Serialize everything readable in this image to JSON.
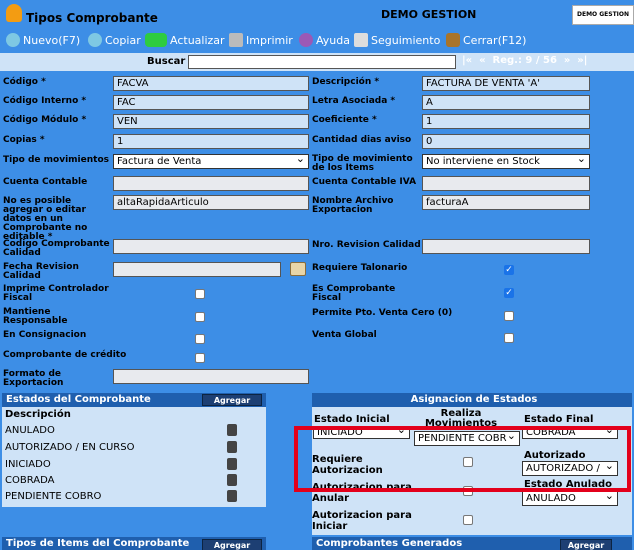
{
  "window": {
    "title": "Tipos Comprobante",
    "app_name": "DEMO GESTION",
    "logo_text": "DEMO GESTION"
  },
  "toolbar": {
    "nuevo": "Nuevo(F7)",
    "copiar": "Copiar",
    "actualizar": "Actualizar",
    "imprimir": "Imprimir",
    "ayuda": "Ayuda",
    "seguimiento": "Seguimiento",
    "cerrar": "Cerrar(F12)"
  },
  "search": {
    "label": "Buscar",
    "value": "",
    "nav": "|«  «  Reg.: 9 / 56  »  »|"
  },
  "form": {
    "codigo": {
      "label": "Código *",
      "value": "FACVA"
    },
    "descripcion": {
      "label": "Descripción *",
      "value": "FACTURA DE VENTA 'A'"
    },
    "codigo_interno": {
      "label": "Código Interno *",
      "value": "FAC"
    },
    "letra_asociada": {
      "label": "Letra Asociada *",
      "value": "A"
    },
    "codigo_modulo": {
      "label": "Código Módulo *",
      "value": "VEN"
    },
    "coeficiente": {
      "label": "Coeficiente *",
      "value": "1"
    },
    "copias": {
      "label": "Copias *",
      "value": "1"
    },
    "cantidad_dias": {
      "label": "Cantidad dias aviso",
      "value": "0"
    },
    "tipo_movimientos": {
      "label": "Tipo de movimientos",
      "value": "Factura de Venta"
    },
    "tipo_mov_items": {
      "label": "Tipo de movimiento de los Items",
      "value": "No interviene en Stock"
    },
    "cuenta_contable": {
      "label": "Cuenta Contable",
      "value": ""
    },
    "cuenta_contable_iva": {
      "label": "Cuenta Contable  IVA",
      "value": ""
    },
    "no_es_posible": {
      "label": "No es posible agregar o editar datos en un Comprobante no editable *",
      "value": "altaRapidaArticulo"
    },
    "nombre_archivo": {
      "label": "Nombre Archivo Exportacion",
      "value": "facturaA"
    },
    "codigo_comp_calidad": {
      "label": "Codigo Comprobante Calidad",
      "value": ""
    },
    "nro_revision": {
      "label": "Nro. Revision Calidad",
      "value": ""
    },
    "fecha_revision": {
      "label": "Fecha Revision Calidad",
      "value": ""
    },
    "requiere_talonario": {
      "label": "Requiere Talonario",
      "checked": true
    },
    "imprime_controlador": {
      "label": "Imprime Controlador Fiscal",
      "checked": false
    },
    "es_comprobante_fiscal": {
      "label": "Es Comprobante Fiscal",
      "checked": true
    },
    "mantiene_responsable": {
      "label": "Mantiene Responsable",
      "checked": false
    },
    "permite_pto_venta": {
      "label": "Permite Pto. Venta Cero (0)",
      "checked": false
    },
    "en_consignacion": {
      "label": "En Consignacion",
      "checked": false
    },
    "venta_global": {
      "label": "Venta Global",
      "checked": false
    },
    "comprobante_credito": {
      "label": "Comprobante de crédito",
      "checked": false
    },
    "formato_exportacion": {
      "label": "Formato de Exportacion",
      "value": ""
    }
  },
  "estados_panel": {
    "title": "Estados del Comprobante",
    "add_label": "Agregar",
    "column": "Descripción",
    "rows": [
      "ANULADO",
      "AUTORIZADO / EN CURSO",
      "INICIADO",
      "COBRADA",
      "PENDIENTE COBRO"
    ]
  },
  "asignacion_panel": {
    "title": "Asignacion de Estados",
    "estado_inicial_label": "Estado Inicial",
    "estado_inicial_value": "INICIADO",
    "realiza_mov_label": "Realiza Movimientos",
    "realiza_mov_value": "PENDIENTE COBR",
    "estado_final_label": "Estado Final",
    "estado_final_value": "COBRADA",
    "requiere_aut_label": "Requiere Autorizacion",
    "autorizado_label": "Autorizado",
    "autorizado_value": "AUTORIZADO /",
    "aut_anular_label": "Autorizacion para Anular",
    "estado_anulado_label": "Estado Anulado",
    "estado_anulado_value": "ANULADO",
    "aut_iniciar_label": "Autorizacion para Iniciar"
  },
  "tipos_items_panel": {
    "title": "Tipos de Items del Comprobante",
    "add_label": "Agregar"
  },
  "comprobantes_gen_panel": {
    "title": "Comprobantes Generados",
    "add_label": "Agregar"
  },
  "colors": {
    "background": "#3d8ee6",
    "field": "#cfe3f7",
    "panel_header": "#1f5fae",
    "highlight": "#e3001b"
  }
}
